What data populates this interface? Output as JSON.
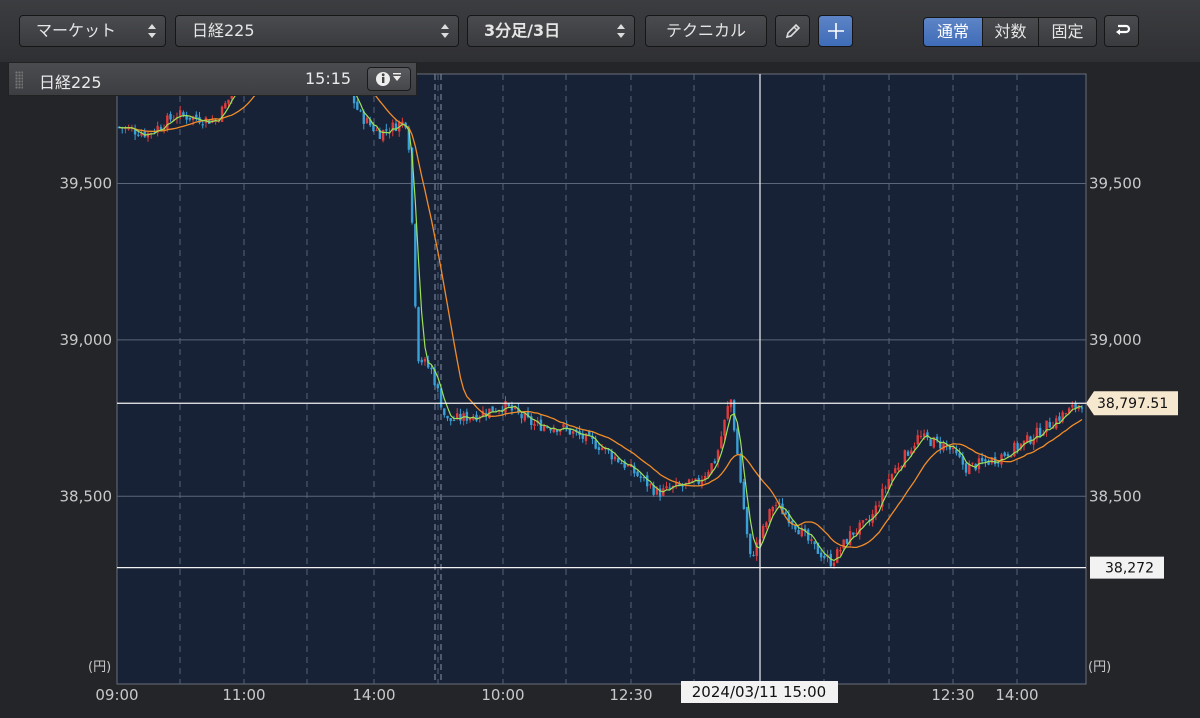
{
  "toolbar": {
    "market_select": "マーケット",
    "symbol_select": "日経225",
    "interval_select": "3分足/3日",
    "technical_button": "テクニカル",
    "scale_normal": "通常",
    "scale_log": "対数",
    "scale_fixed": "固定"
  },
  "panel": {
    "symbol": "日経225",
    "time": "15:15"
  },
  "chart": {
    "unit_label": "(円)",
    "last_price_label": "38,797.51",
    "low_label": "38,272",
    "crosshair_time_label": "2024/03/11 15:00",
    "colors": {
      "up": "#e03c3c",
      "down": "#3aa0d8",
      "ma_short": "#9be25a",
      "ma_long": "#f28c28",
      "background": "#172236"
    }
  },
  "chart_data": {
    "type": "line",
    "series_kind": "candlestick",
    "y_ticks": [
      39500,
      39000,
      38500
    ],
    "y_tick_labels": [
      "39,500",
      "39,000",
      "38,500"
    ],
    "x_tick_labels": [
      "09:00",
      "11:00",
      "14:00",
      "10:00",
      "12:30",
      "",
      "12:30",
      "14:00"
    ],
    "ylim": [
      37900,
      39850
    ],
    "grid": true,
    "reference_lines": [
      38797.51,
      38272
    ],
    "close_path": {
      "t": [
        0,
        0.03,
        0.06,
        0.1,
        0.12,
        0.14,
        0.17,
        0.2,
        0.23,
        0.25,
        0.27,
        0.29,
        0.3,
        0.31,
        0.325,
        0.34,
        0.37,
        0.4,
        0.43,
        0.46,
        0.5,
        0.53,
        0.56,
        0.58,
        0.6,
        0.62,
        0.635,
        0.655,
        0.665,
        0.68,
        0.7,
        0.72,
        0.74,
        0.76,
        0.78,
        0.8,
        0.83,
        0.86,
        0.88,
        0.91,
        0.94,
        0.97,
        1.0
      ],
      "v": [
        39680,
        39660,
        39720,
        39700,
        39800,
        39890,
        39900,
        39890,
        39860,
        39720,
        39660,
        39690,
        39700,
        38950,
        38900,
        38740,
        38760,
        38790,
        38730,
        38720,
        38660,
        38590,
        38510,
        38530,
        38540,
        38620,
        38820,
        38300,
        38360,
        38480,
        38420,
        38340,
        38290,
        38380,
        38420,
        38560,
        38690,
        38660,
        38590,
        38620,
        38670,
        38740,
        38800
      ]
    }
  }
}
